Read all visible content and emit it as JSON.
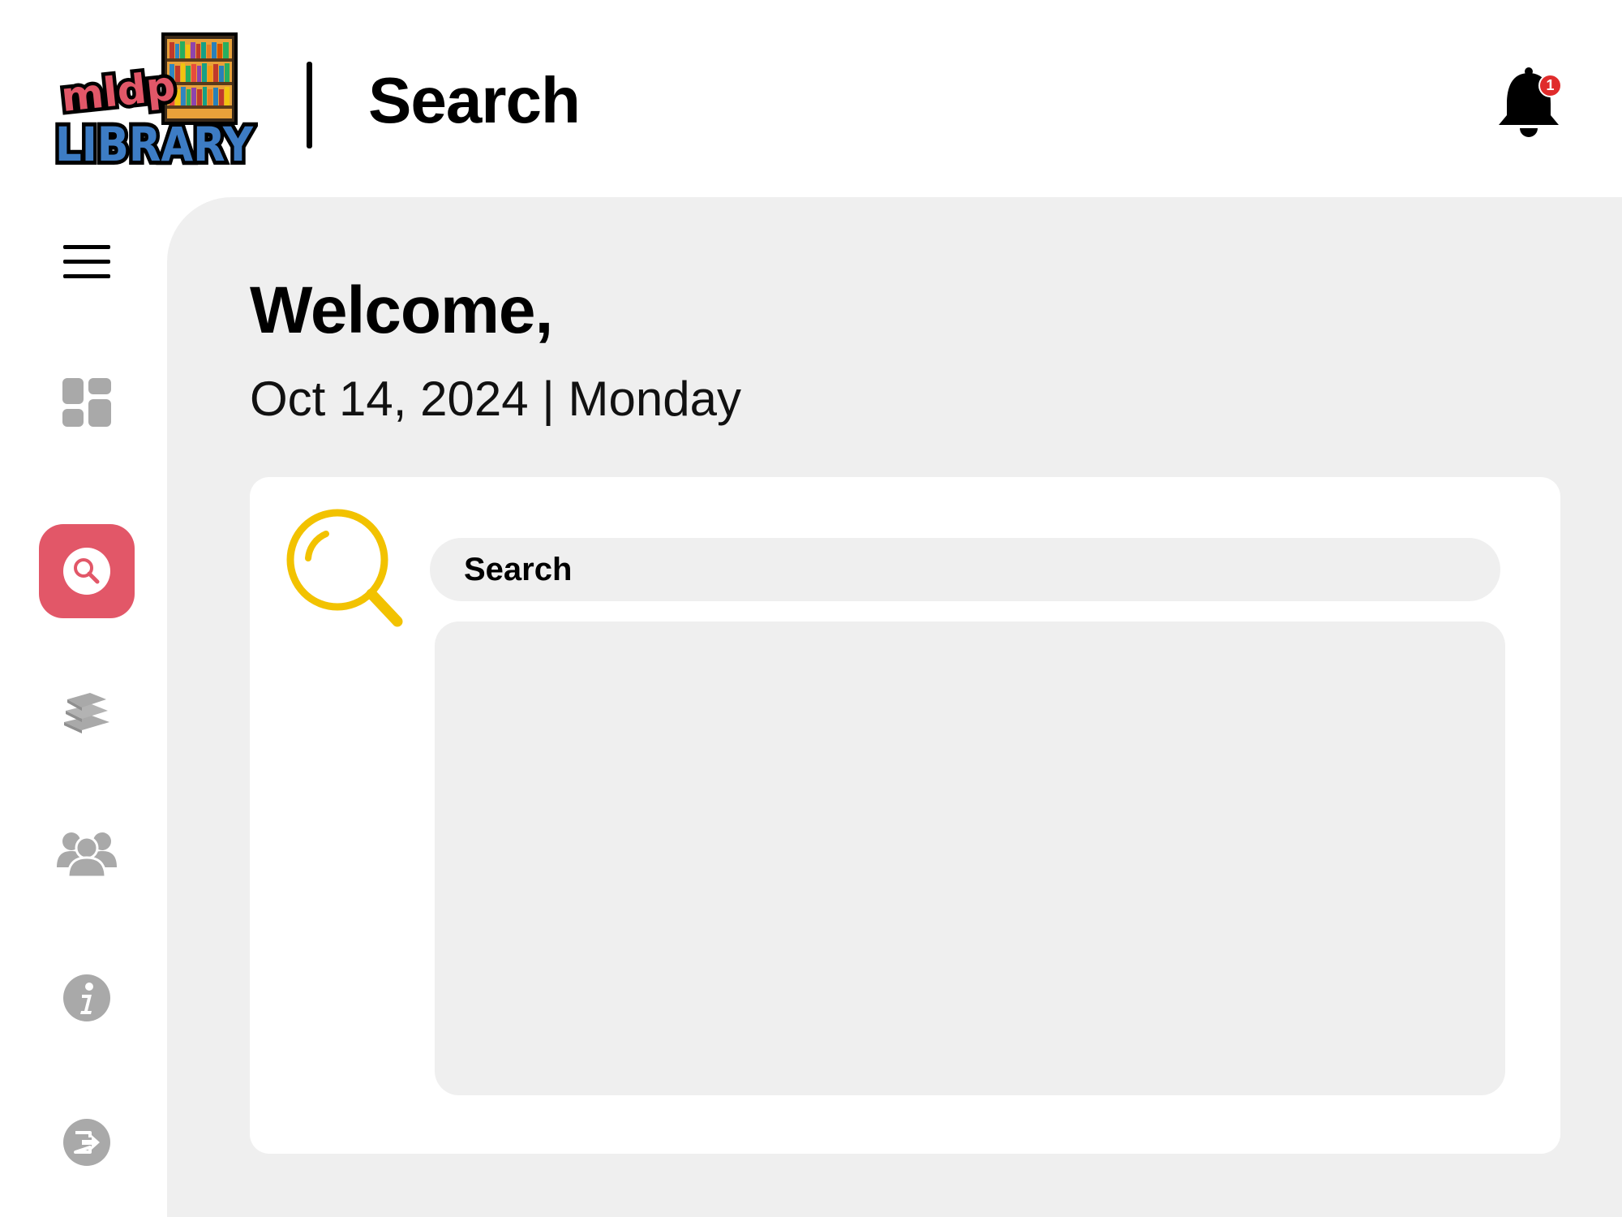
{
  "header": {
    "logo_top_text": "mldp",
    "logo_bottom_text": "LIBRARY",
    "title": "Search",
    "notification_count": "1"
  },
  "sidebar": {
    "items": [
      {
        "icon": "menu-icon",
        "active": false
      },
      {
        "icon": "dashboard-icon",
        "active": false
      },
      {
        "icon": "search-icon",
        "active": true
      },
      {
        "icon": "books-icon",
        "active": false
      },
      {
        "icon": "users-icon",
        "active": false
      },
      {
        "icon": "info-icon",
        "active": false
      },
      {
        "icon": "logout-icon",
        "active": false
      }
    ]
  },
  "main": {
    "welcome": "Welcome,",
    "date": "Oct 14, 2024 | Monday",
    "search": {
      "placeholder": "Search",
      "value": ""
    }
  },
  "colors": {
    "accent": "#e25768",
    "magnifier": "#f2c200",
    "icon_gray": "#a9a9a9",
    "panel_bg": "#efefef",
    "badge": "#e02b2b"
  }
}
